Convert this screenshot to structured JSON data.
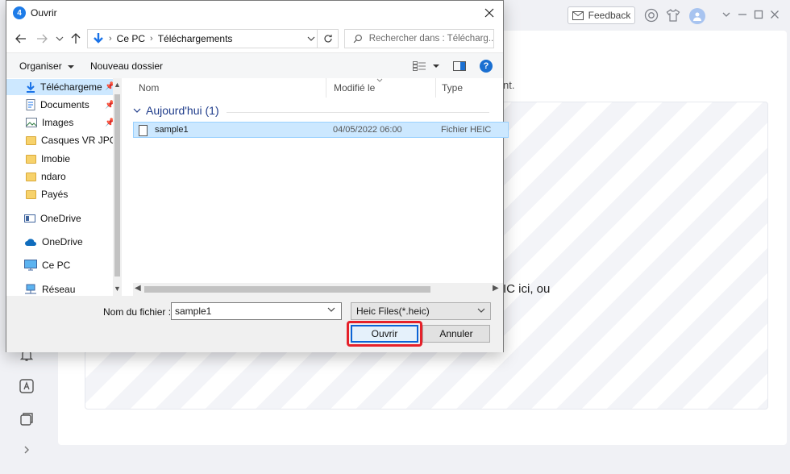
{
  "app": {
    "feedback_label": "Feedback",
    "hint_text": "nt.",
    "drop_text": "IC ici, ou"
  },
  "dialog": {
    "title": "Ouvrir",
    "address": {
      "root": "Ce PC",
      "folder": "Téléchargements"
    },
    "search_placeholder": "Rechercher dans : Télécharg...",
    "toolbar": {
      "organize": "Organiser",
      "new_folder": "Nouveau dossier"
    },
    "nav_items": [
      {
        "label": "Téléchargeme",
        "icon": "download-arrow-icon",
        "pinned": true,
        "selected": true
      },
      {
        "label": "Documents",
        "icon": "document-icon",
        "pinned": true
      },
      {
        "label": "Images",
        "icon": "image-icon",
        "pinned": true
      },
      {
        "label": "Casques VR JPG",
        "icon": "folder-icon"
      },
      {
        "label": "Imobie",
        "icon": "folder-icon"
      },
      {
        "label": "ndaro",
        "icon": "folder-icon"
      },
      {
        "label": "Payés",
        "icon": "folder-icon"
      },
      {
        "label": "OneDrive",
        "icon": "onedrive-icon"
      },
      {
        "label": "OneDrive",
        "icon": "cloud-icon"
      },
      {
        "label": "Ce PC",
        "icon": "computer-icon"
      },
      {
        "label": "Réseau",
        "icon": "network-icon"
      }
    ],
    "columns": [
      "Nom",
      "Modifié le",
      "Type"
    ],
    "group_label": "Aujourd'hui (1)",
    "files": [
      {
        "name": "sample1",
        "modified": "04/05/2022 06:00",
        "type": "Fichier HEIC"
      }
    ],
    "filename_label": "Nom du fichier :",
    "filename_value": "sample1",
    "filetype": "Heic Files(*.heic)",
    "open_label": "Ouvrir",
    "cancel_label": "Annuler"
  }
}
